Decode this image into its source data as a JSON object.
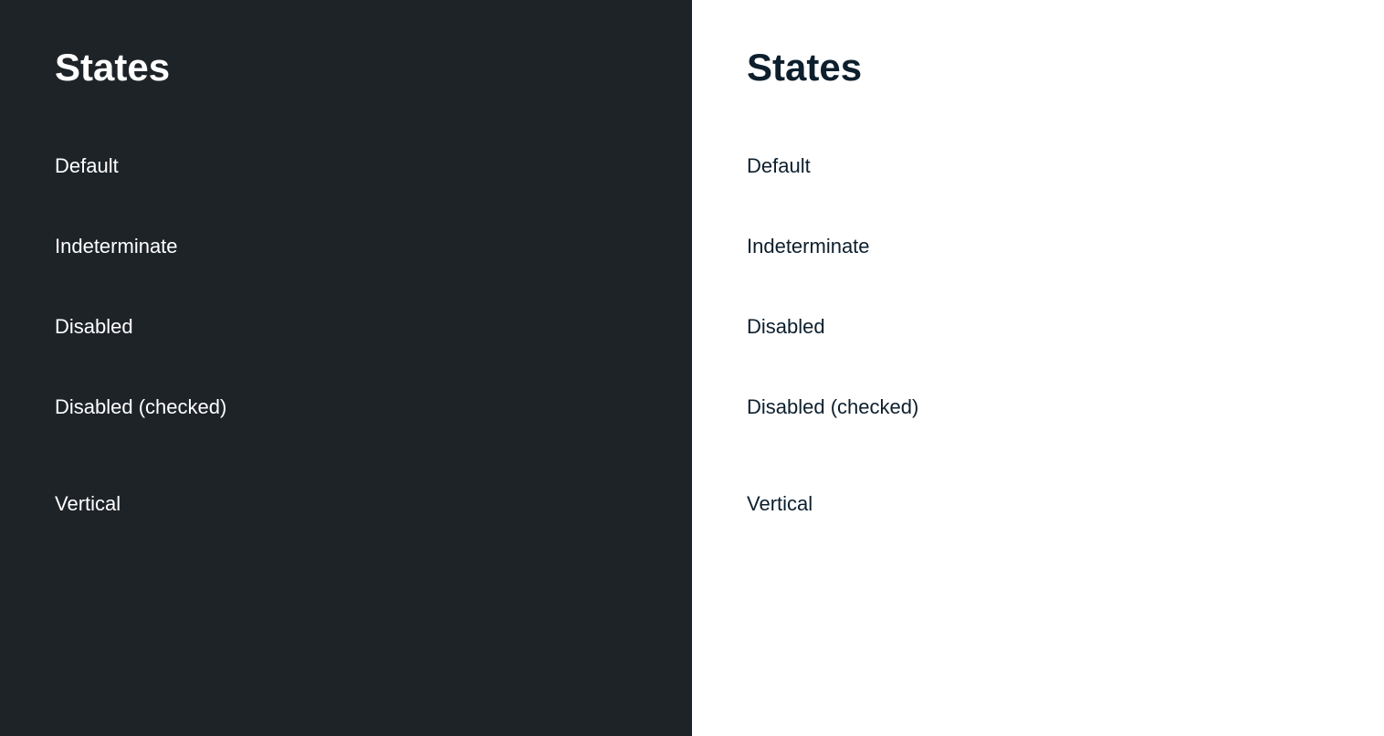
{
  "dark_panel": {
    "title": "States",
    "states": [
      {
        "id": "default",
        "label": "Default"
      },
      {
        "id": "indeterminate",
        "label": "Indeterminate"
      },
      {
        "id": "disabled",
        "label": "Disabled"
      },
      {
        "id": "disabled-checked",
        "label": "Disabled (checked)"
      },
      {
        "id": "vertical",
        "label": "Vertical"
      }
    ]
  },
  "light_panel": {
    "title": "States",
    "states": [
      {
        "id": "default",
        "label": "Default"
      },
      {
        "id": "indeterminate",
        "label": "Indeterminate"
      },
      {
        "id": "disabled",
        "label": "Disabled"
      },
      {
        "id": "disabled-checked",
        "label": "Disabled (checked)"
      },
      {
        "id": "vertical",
        "label": "Vertical"
      }
    ]
  },
  "colors": {
    "dark_bg": "#1e2328",
    "light_bg": "#ffffff",
    "green": "#7ac231",
    "dark_title": "#ffffff",
    "light_title": "#0d1f2d"
  }
}
